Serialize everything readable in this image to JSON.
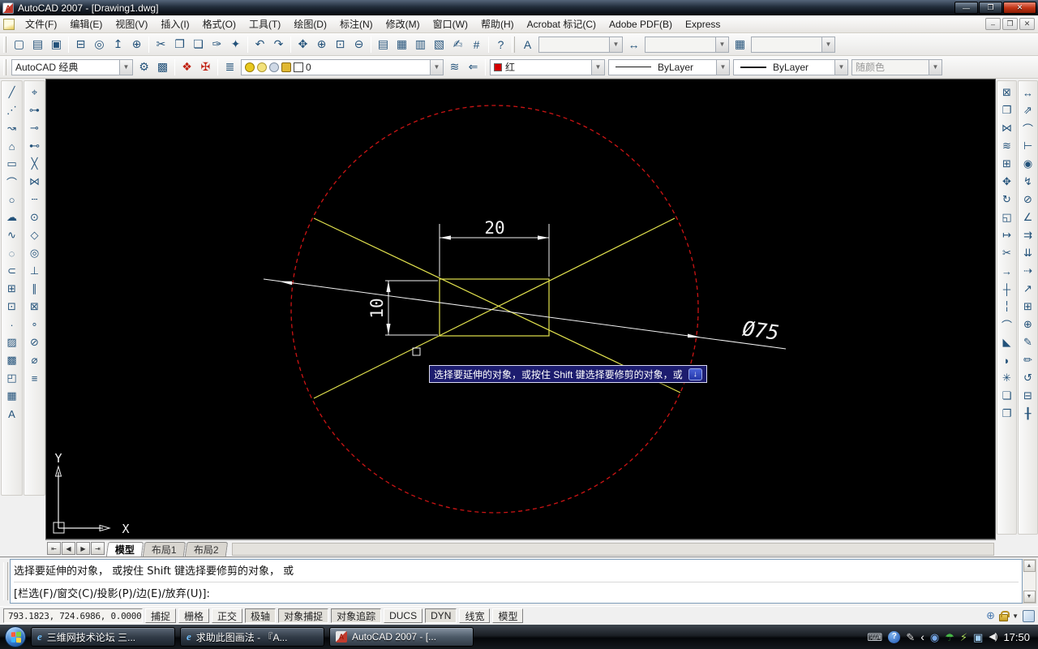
{
  "window": {
    "title": "AutoCAD 2007 - [Drawing1.dwg]",
    "controls": {
      "minimize": "—",
      "restore": "❐",
      "close": "✕"
    },
    "mdi": {
      "minimize": "–",
      "restore": "❐",
      "close": "✕"
    }
  },
  "menu": {
    "items": [
      {
        "name": "menu-file",
        "label": "文件(F)"
      },
      {
        "name": "menu-edit",
        "label": "编辑(E)"
      },
      {
        "name": "menu-view",
        "label": "视图(V)"
      },
      {
        "name": "menu-insert",
        "label": "插入(I)"
      },
      {
        "name": "menu-format",
        "label": "格式(O)"
      },
      {
        "name": "menu-tools",
        "label": "工具(T)"
      },
      {
        "name": "menu-draw",
        "label": "绘图(D)"
      },
      {
        "name": "menu-dimension",
        "label": "标注(N)"
      },
      {
        "name": "menu-modify",
        "label": "修改(M)"
      },
      {
        "name": "menu-window",
        "label": "窗口(W)"
      },
      {
        "name": "menu-help",
        "label": "帮助(H)"
      },
      {
        "name": "menu-acrobat-markup",
        "label": "Acrobat 标记(C)"
      },
      {
        "name": "menu-adobe-pdf",
        "label": "Adobe PDF(B)"
      },
      {
        "name": "menu-express",
        "label": "Express"
      }
    ]
  },
  "toolbar_std": {
    "g0": [
      {
        "name": "new-file-button",
        "glyph": "▢"
      },
      {
        "name": "open-file-button",
        "glyph": "▤"
      },
      {
        "name": "save-button",
        "glyph": "▣"
      }
    ],
    "g1": [
      {
        "name": "plot-button",
        "glyph": "⊟"
      },
      {
        "name": "plot-preview-button",
        "glyph": "◎"
      },
      {
        "name": "publish-button",
        "glyph": "↥"
      },
      {
        "name": "web-button",
        "glyph": "⊕"
      }
    ],
    "g2": [
      {
        "name": "cut-button",
        "glyph": "✂"
      },
      {
        "name": "copy-button",
        "glyph": "❐"
      },
      {
        "name": "paste-button",
        "glyph": "❏"
      },
      {
        "name": "match-properties-button",
        "glyph": "✑"
      },
      {
        "name": "block-editor-button",
        "glyph": "✦"
      }
    ],
    "g3": [
      {
        "name": "undo-button",
        "glyph": "↶"
      },
      {
        "name": "redo-button",
        "glyph": "↷"
      }
    ],
    "g4": [
      {
        "name": "pan-button",
        "glyph": "✥"
      },
      {
        "name": "zoom-realtime-button",
        "glyph": "⊕"
      },
      {
        "name": "zoom-window-button",
        "glyph": "⊡"
      },
      {
        "name": "zoom-previous-button",
        "glyph": "⊖"
      }
    ],
    "g5": [
      {
        "name": "properties-palette-button",
        "glyph": "▤"
      },
      {
        "name": "designcenter-button",
        "glyph": "▦"
      },
      {
        "name": "tool-palettes-button",
        "glyph": "▥"
      },
      {
        "name": "sheet-set-manager-button",
        "glyph": "▧"
      },
      {
        "name": "markup-button",
        "glyph": "✍"
      },
      {
        "name": "quick-calc-button",
        "glyph": "#"
      }
    ],
    "g6": [
      {
        "name": "help-button",
        "glyph": "?"
      }
    ],
    "style_icons": {
      "text": "A",
      "dim": "↔",
      "table": "▦"
    }
  },
  "toolbar_row2": {
    "workspace": "AutoCAD 经典",
    "icons": [
      {
        "name": "workspace-settings-button",
        "glyph": "⚙"
      },
      {
        "name": "workspace-save-button",
        "glyph": "▩"
      },
      {
        "name": "acrobat-convert-button",
        "glyph": "❖"
      },
      {
        "name": "acrobat-batch-button",
        "glyph": "✠"
      },
      {
        "name": "layer-manager-button",
        "glyph": "≣"
      },
      {
        "name": "layer-states-button",
        "glyph": "≋"
      },
      {
        "name": "layer-previous-button",
        "glyph": "⇐"
      }
    ],
    "layer_value": "0",
    "layer_swatches": [
      {
        "name": "layer-on-icon",
        "css": "background:#e8c81e;border-radius:50%;border:1px solid #9a7d00"
      },
      {
        "name": "layer-freeze-icon",
        "css": "background:#f3e27a;border-radius:50%;border:1px solid #b09a30"
      },
      {
        "name": "layer-plot-icon",
        "css": "background:#cfd9e6;border-radius:50%;border:1px solid #7d8da0"
      },
      {
        "name": "layer-lock-icon",
        "css": "background:#e0b832;border-radius:2px;border:1px solid #8a6a10"
      },
      {
        "name": "layer-color-swatch",
        "css": "background:#fff;border:1px solid #444"
      }
    ],
    "color": {
      "label": "红",
      "swatch": "#d40000"
    },
    "linetype": "ByLayer",
    "lineweight": "ByLayer",
    "plotstyle": "随颜色"
  },
  "draw_toolbar": {
    "icons": [
      {
        "name": "line-button",
        "glyph": "╱"
      },
      {
        "name": "construction-line-button",
        "glyph": "⋰"
      },
      {
        "name": "polyline-button",
        "glyph": "↝"
      },
      {
        "name": "polygon-button",
        "glyph": "⌂"
      },
      {
        "name": "rectangle-button",
        "glyph": "▭"
      },
      {
        "name": "arc-button",
        "glyph": "⌒"
      },
      {
        "name": "circle-button",
        "glyph": "○"
      },
      {
        "name": "revision-cloud-button",
        "glyph": "☁"
      },
      {
        "name": "spline-button",
        "glyph": "∿"
      },
      {
        "name": "ellipse-button",
        "glyph": "◌"
      },
      {
        "name": "ellipse-arc-button",
        "glyph": "⊂"
      },
      {
        "name": "insert-block-button",
        "glyph": "⊞"
      },
      {
        "name": "make-block-button",
        "glyph": "⊡"
      },
      {
        "name": "point-button",
        "glyph": "·"
      },
      {
        "name": "hatch-button",
        "glyph": "▨"
      },
      {
        "name": "gradient-button",
        "glyph": "▩"
      },
      {
        "name": "region-button",
        "glyph": "◰"
      },
      {
        "name": "table-button",
        "glyph": "▦"
      },
      {
        "name": "multiline-text-button",
        "glyph": "A"
      }
    ]
  },
  "osnap_toolbar": {
    "icons": [
      {
        "name": "temporary-track-point-button",
        "glyph": "⌖"
      },
      {
        "name": "snap-from-button",
        "glyph": "⊶"
      },
      {
        "name": "snap-endpoint-button",
        "glyph": "⊸"
      },
      {
        "name": "snap-midpoint-button",
        "glyph": "⊷"
      },
      {
        "name": "snap-intersection-button",
        "glyph": "╳"
      },
      {
        "name": "snap-apparent-intersection-button",
        "glyph": "⋈"
      },
      {
        "name": "snap-extension-button",
        "glyph": "┄"
      },
      {
        "name": "snap-center-button",
        "glyph": "⊙"
      },
      {
        "name": "snap-quadrant-button",
        "glyph": "◇"
      },
      {
        "name": "snap-tangent-button",
        "glyph": "◎"
      },
      {
        "name": "snap-perpendicular-button",
        "glyph": "⊥"
      },
      {
        "name": "snap-parallel-button",
        "glyph": "∥"
      },
      {
        "name": "snap-insert-button",
        "glyph": "⊠"
      },
      {
        "name": "snap-node-button",
        "glyph": "∘"
      },
      {
        "name": "snap-nearest-button",
        "glyph": "⊘"
      },
      {
        "name": "snap-none-button",
        "glyph": "⌀"
      },
      {
        "name": "osnap-settings-button",
        "glyph": "≡"
      }
    ]
  },
  "modify_toolbar": {
    "icons": [
      {
        "name": "erase-button",
        "glyph": "⊠"
      },
      {
        "name": "copy-object-button",
        "glyph": "❐"
      },
      {
        "name": "mirror-button",
        "glyph": "⋈"
      },
      {
        "name": "offset-button",
        "glyph": "≋"
      },
      {
        "name": "array-button",
        "glyph": "⊞"
      },
      {
        "name": "move-button",
        "glyph": "✥"
      },
      {
        "name": "rotate-button",
        "glyph": "↻"
      },
      {
        "name": "scale-button",
        "glyph": "◱"
      },
      {
        "name": "stretch-button",
        "glyph": "↦"
      },
      {
        "name": "trim-button",
        "glyph": "✂"
      },
      {
        "name": "extend-button",
        "glyph": "→"
      },
      {
        "name": "break-at-point-button",
        "glyph": "┼"
      },
      {
        "name": "break-button",
        "glyph": "╎"
      },
      {
        "name": "join-button",
        "glyph": "⌒"
      },
      {
        "name": "chamfer-button",
        "glyph": "◣"
      },
      {
        "name": "fillet-button",
        "glyph": "◗"
      },
      {
        "name": "explode-button",
        "glyph": "✳"
      },
      {
        "name": "draworder-front-button",
        "glyph": "❏"
      },
      {
        "name": "draworder-back-button",
        "glyph": "❐"
      }
    ]
  },
  "dimension_toolbar": {
    "icons": [
      {
        "name": "dim-linear-button",
        "glyph": "↔"
      },
      {
        "name": "dim-aligned-button",
        "glyph": "⇗"
      },
      {
        "name": "dim-arc-length-button",
        "glyph": "⌒"
      },
      {
        "name": "dim-ordinate-button",
        "glyph": "⊢"
      },
      {
        "name": "dim-radius-button",
        "glyph": "◉"
      },
      {
        "name": "dim-jogged-button",
        "glyph": "↯"
      },
      {
        "name": "dim-diameter-button",
        "glyph": "⊘"
      },
      {
        "name": "dim-angular-button",
        "glyph": "∠"
      },
      {
        "name": "quick-dimension-button",
        "glyph": "⇉"
      },
      {
        "name": "dim-baseline-button",
        "glyph": "⇊"
      },
      {
        "name": "dim-continue-button",
        "glyph": "⇢"
      },
      {
        "name": "quick-leader-button",
        "glyph": "↗"
      },
      {
        "name": "tolerance-button",
        "glyph": "⊞"
      },
      {
        "name": "center-mark-button",
        "glyph": "⊕"
      },
      {
        "name": "dim-edit-button",
        "glyph": "✎"
      },
      {
        "name": "dim-text-edit-button",
        "glyph": "✏"
      },
      {
        "name": "dim-update-button",
        "glyph": "↺"
      },
      {
        "name": "dim-style-button",
        "glyph": "⊟"
      },
      {
        "name": "dim-break-button",
        "glyph": "╂"
      }
    ]
  },
  "canvas": {
    "dim_width": "20",
    "dim_height": "10",
    "dim_diameter": "Ø75",
    "ucs_x": "X",
    "ucs_y": "Y",
    "tooltip": {
      "text": "选择要延伸的对象，或按住 Shift 键选择要修剪的对象，或",
      "key": "↓"
    },
    "colors": {
      "circle": "#cc1414",
      "geometry": "#e2e24e",
      "dimension": "#f2f2f2"
    }
  },
  "layout_tabs": {
    "nav": {
      "first": "⇤",
      "prev": "◀",
      "next": "▶",
      "last": "⇥"
    },
    "tabs": [
      {
        "name": "tab-model",
        "label": "模型",
        "active": true
      },
      {
        "name": "tab-layout1",
        "label": "布局1"
      },
      {
        "name": "tab-layout2",
        "label": "布局2"
      }
    ]
  },
  "command": {
    "line1": "选择要延伸的对象， 或按住 Shift 键选择要修剪的对象， 或",
    "line2": "[栏选(F)/窗交(C)/投影(P)/边(E)/放弃(U)]:",
    "scroll_up": "▲",
    "scroll_down": "▼"
  },
  "status": {
    "coords": "793.1823, 724.6986, 0.0000",
    "toggles": [
      {
        "name": "toggle-snap",
        "label": "捕捉"
      },
      {
        "name": "toggle-grid",
        "label": "栅格"
      },
      {
        "name": "toggle-ortho",
        "label": "正交"
      },
      {
        "name": "toggle-polar",
        "label": "极轴",
        "pressed": true
      },
      {
        "name": "toggle-osnap",
        "label": "对象捕捉",
        "pressed": true
      },
      {
        "name": "toggle-otrack",
        "label": "对象追踪",
        "pressed": true
      },
      {
        "name": "toggle-ducs",
        "label": "DUCS"
      },
      {
        "name": "toggle-dyn",
        "label": "DYN",
        "pressed": true
      },
      {
        "name": "toggle-lwt",
        "label": "线宽"
      },
      {
        "name": "toggle-model",
        "label": "模型"
      }
    ],
    "dropdown": "▼"
  },
  "taskbar": {
    "buttons": [
      {
        "icon_name": "ie-icon",
        "glyph": "e",
        "label": "三维网技术论坛 三..."
      },
      {
        "icon_name": "ie-icon",
        "glyph": "e",
        "label": "求助此图画法 - 『A..."
      },
      {
        "icon_name": "autocad-icon",
        "glyph": "A",
        "label": "AutoCAD 2007 - [...",
        "active": true
      }
    ],
    "tray": [
      {
        "name": "keyboard-tray-icon",
        "glyph": "⌨"
      },
      {
        "name": "help-tray-icon",
        "glyph": "?"
      },
      {
        "name": "pen-tray-icon",
        "glyph": "✎"
      },
      {
        "name": "chevron-icon",
        "glyph": "‹"
      },
      {
        "name": "antivirus-tray-icon",
        "glyph": "◉"
      },
      {
        "name": "umbrella-tray-icon",
        "glyph": "☂"
      },
      {
        "name": "power-tray-icon",
        "glyph": "⚡"
      },
      {
        "name": "network-tray-icon",
        "glyph": "▣"
      },
      {
        "name": "volume-tray-icon",
        "glyph": "◀)"
      }
    ],
    "clock": "17:50"
  }
}
